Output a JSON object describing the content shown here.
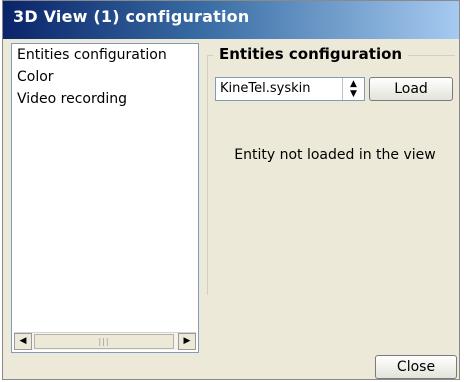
{
  "window": {
    "title": "3D View (1) configuration"
  },
  "sidebar": {
    "items": [
      {
        "label": "Entities configuration",
        "selected": true
      },
      {
        "label": "Color",
        "selected": false
      },
      {
        "label": "Video recording",
        "selected": false
      }
    ],
    "scrollbar": {
      "left_icon": "arrow-left-icon",
      "right_icon": "arrow-right-icon"
    }
  },
  "config": {
    "title": "Entities configuration",
    "entity_select": {
      "value": "KineTel.syskin"
    },
    "load_label": "Load",
    "status": "Entity not loaded in the view"
  },
  "footer": {
    "close_label": "Close"
  },
  "colors": {
    "titlebar_start": "#0a246a",
    "titlebar_end": "#a6caf0",
    "panel": "#ece9d8"
  }
}
